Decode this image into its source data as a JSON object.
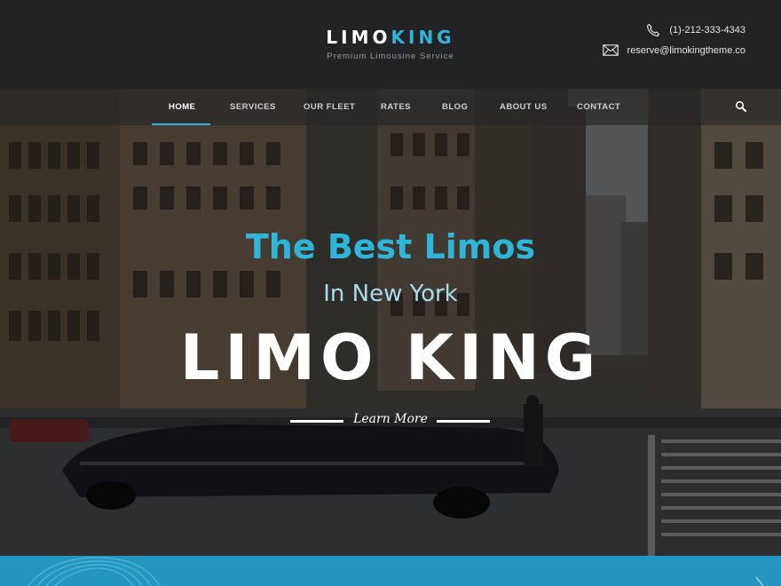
{
  "header": {
    "logo_part1": "LIMO",
    "logo_part2": "KING",
    "tagline": "Premium Limousine Service",
    "phone": "(1)-212-333-4343",
    "email": "reserve@limokingtheme.co"
  },
  "nav": {
    "items": [
      {
        "label": "HOME"
      },
      {
        "label": "SERVICES"
      },
      {
        "label": "OUR FLEET"
      },
      {
        "label": "RATES"
      },
      {
        "label": "BLOG"
      },
      {
        "label": "ABOUT US"
      },
      {
        "label": "CONTACT"
      }
    ],
    "active_index": 0
  },
  "hero": {
    "title": "The Best Limos",
    "subtitle": "In New York",
    "brand": "LIMO KING",
    "cta": "Learn More"
  },
  "colors": {
    "accent": "#2fb5d8",
    "header_bg": "#222324",
    "band": "#2496c0"
  },
  "icons": [
    "phone-icon",
    "envelope-icon",
    "search-icon"
  ]
}
